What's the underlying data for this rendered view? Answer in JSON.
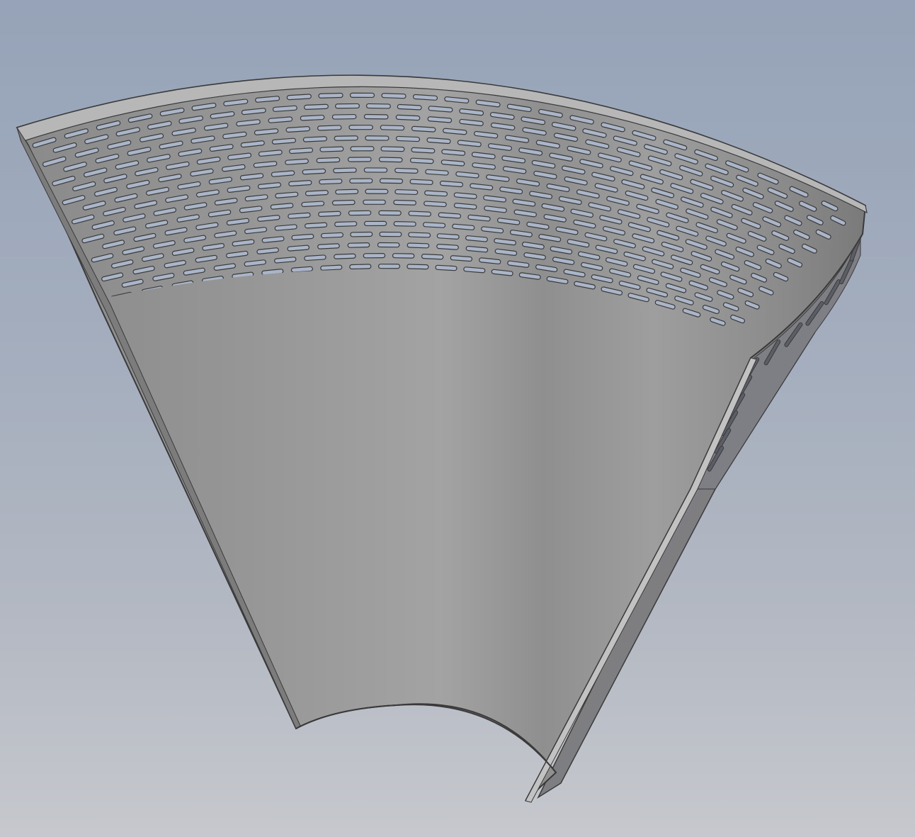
{
  "viewport": {
    "background_top": "#96a3b8",
    "background_bottom": "#c6c8cd"
  },
  "model": {
    "part": "perforated-conical-shell",
    "surface_color": "#9c9c9c",
    "slot_color": "#aab6c8",
    "edge_color": "#3a3a3a",
    "slot_rows": 17
  }
}
